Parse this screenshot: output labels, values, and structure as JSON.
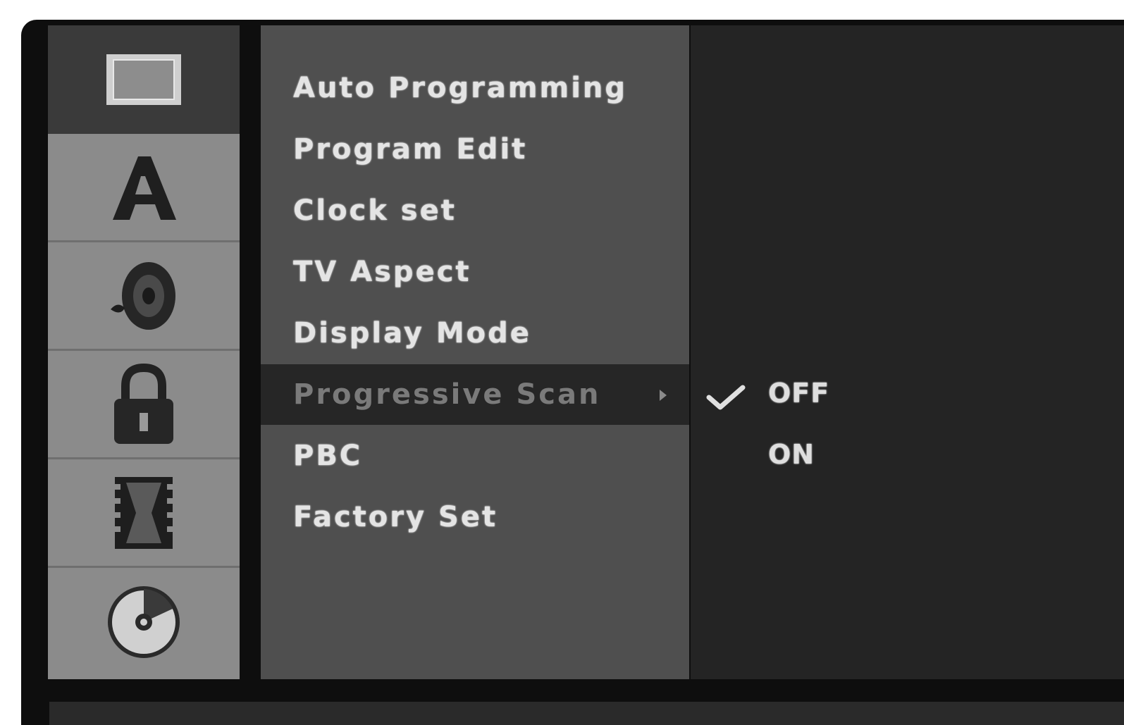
{
  "sidebar": {
    "items": [
      {
        "icon": "tv-screen-icon",
        "selected": true
      },
      {
        "icon": "letter-a-icon",
        "selected": false
      },
      {
        "icon": "speaker-icon",
        "selected": false
      },
      {
        "icon": "lock-icon",
        "selected": false
      },
      {
        "icon": "film-icon",
        "selected": false
      },
      {
        "icon": "disc-icon",
        "selected": false
      }
    ]
  },
  "menu": {
    "items": [
      {
        "label": "Auto Programming"
      },
      {
        "label": "Program Edit"
      },
      {
        "label": "Clock set"
      },
      {
        "label": "TV Aspect"
      },
      {
        "label": "Display Mode"
      },
      {
        "label": "Progressive Scan",
        "selected": true
      },
      {
        "label": "PBC"
      },
      {
        "label": "Factory Set"
      }
    ]
  },
  "options": {
    "items": [
      {
        "label": "OFF",
        "checked": true
      },
      {
        "label": "ON",
        "checked": false
      }
    ]
  }
}
